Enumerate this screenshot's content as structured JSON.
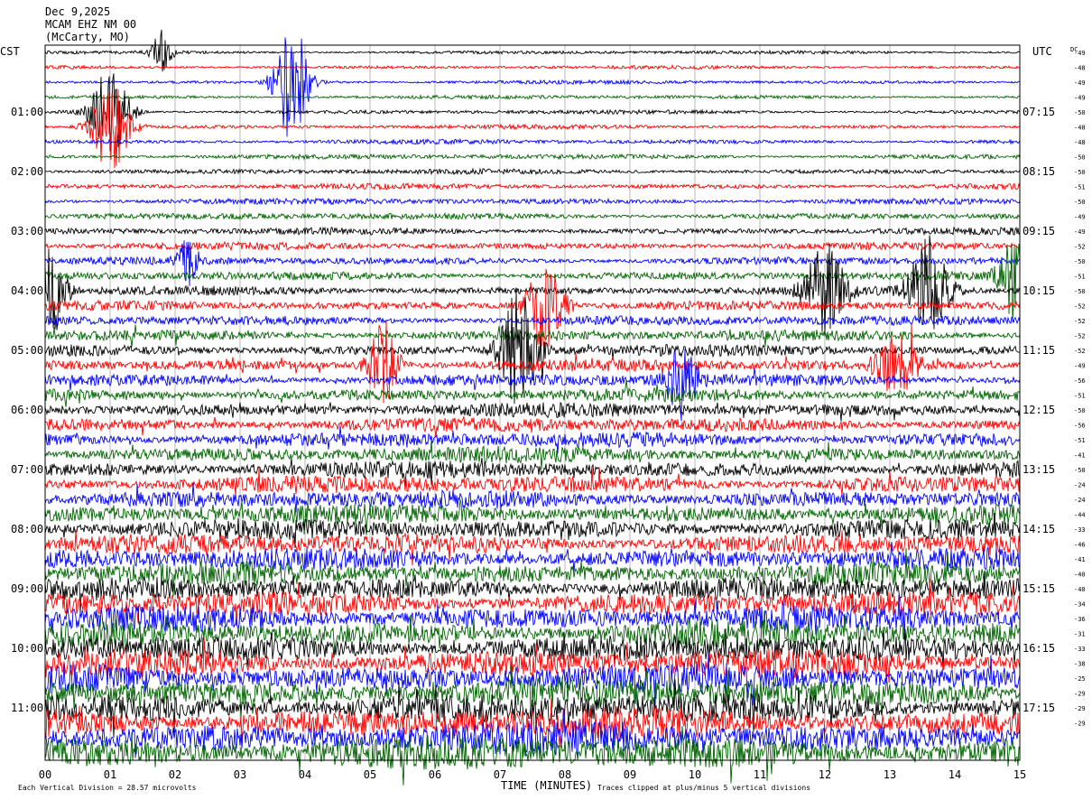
{
  "header": {
    "date": "Dec 9,2025",
    "station": "MCAM EHZ NM 00",
    "location": "(McCarty, MO)"
  },
  "left_axis_title": "CST",
  "right_axis_title": "UTC",
  "dc_title": "DC",
  "footer": {
    "division_note": "Each Vertical Division = 28.57 microvolts",
    "clip_note": "Traces clipped at plus/minus 5 vertical divisions",
    "xaxis_title": "TIME (MINUTES)"
  },
  "chart_data": {
    "type": "line",
    "description_type": "helicorder",
    "x_ticks": [
      "00",
      "01",
      "02",
      "03",
      "04",
      "05",
      "06",
      "07",
      "08",
      "09",
      "10",
      "11",
      "12",
      "13",
      "14",
      "15"
    ],
    "xlim": [
      0,
      15
    ],
    "trace_colors": [
      "#000000",
      "#ff0000",
      "#0000ff",
      "#006400"
    ],
    "trace_count": 48,
    "cst_labels": [
      "01:00",
      "02:00",
      "03:00",
      "04:00",
      "05:00",
      "06:00",
      "07:00",
      "08:00",
      "09:00",
      "10:00",
      "11:00"
    ],
    "utc_labels": [
      "07:15",
      "08:15",
      "09:15",
      "10:15",
      "11:15",
      "12:15",
      "13:15",
      "14:15",
      "15:15",
      "16:15",
      "17:15"
    ],
    "dc_offsets": [
      -49,
      -48,
      -49,
      -49,
      -50,
      -48,
      -48,
      -50,
      -50,
      -51,
      -50,
      -49,
      -49,
      -52,
      -50,
      -51,
      -50,
      -52,
      -52,
      -52,
      -52,
      -49,
      -56,
      -51,
      -50,
      -56,
      -51,
      -41,
      -50,
      -24,
      -24,
      -44,
      -33,
      -46,
      -41,
      -40,
      -40,
      -34,
      -36,
      -31,
      -33,
      -38,
      -25,
      -29,
      -29,
      -29
    ],
    "events": [
      {
        "trace": 0,
        "minute": 1.8,
        "amp": 1.5,
        "width": 0.2
      },
      {
        "trace": 2,
        "minute": 3.8,
        "amp": 4.0,
        "width": 0.35
      },
      {
        "trace": 4,
        "minute": 1.0,
        "amp": 3.0,
        "width": 0.4
      },
      {
        "trace": 5,
        "minute": 1.0,
        "amp": 3.0,
        "width": 0.4
      },
      {
        "trace": 14,
        "minute": 2.2,
        "amp": 1.5,
        "width": 0.2
      },
      {
        "trace": 16,
        "minute": 0.1,
        "amp": 3.0,
        "width": 0.3
      },
      {
        "trace": 16,
        "minute": 12.0,
        "amp": 3.0,
        "width": 0.4
      },
      {
        "trace": 16,
        "minute": 13.6,
        "amp": 3.5,
        "width": 0.4
      },
      {
        "trace": 15,
        "minute": 14.9,
        "amp": 3.0,
        "width": 0.3
      },
      {
        "trace": 17,
        "minute": 7.7,
        "amp": 3.0,
        "width": 0.4
      },
      {
        "trace": 20,
        "minute": 7.3,
        "amp": 4.0,
        "width": 0.4
      },
      {
        "trace": 21,
        "minute": 5.2,
        "amp": 3.0,
        "width": 0.3
      },
      {
        "trace": 21,
        "minute": 13.1,
        "amp": 2.0,
        "width": 0.4
      },
      {
        "trace": 22,
        "minute": 9.8,
        "amp": 2.5,
        "width": 0.3
      }
    ]
  }
}
